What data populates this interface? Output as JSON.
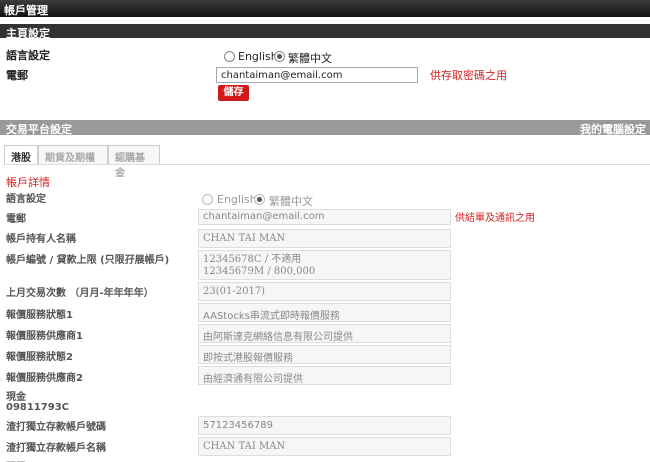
{
  "window": {
    "title": "帳戶管理"
  },
  "home": {
    "section_title": "主頁設定",
    "language_label": "語言設定",
    "language_options": [
      "English",
      "繁體中文"
    ],
    "email_label": "電郵",
    "email_value": "chantaiman@email.com",
    "email_hint": "供存取密碼之用",
    "save_label": "儲存"
  },
  "trading": {
    "section_title": "交易平台設定",
    "right_link": "我的電腦設定",
    "tabs": [
      "港股",
      "期貨及期權",
      "認購基金"
    ],
    "subheader": "帳戶詳情",
    "language_label": "語言設定",
    "language_options": [
      "English",
      "繁體中文"
    ],
    "email_label": "電郵",
    "email_value": "chantaiman@email.com",
    "email_hint": "供結單及通訊之用",
    "holder_label": "帳戶持有人名稱",
    "holder_value": "CHAN TAI MAN",
    "account_label": "帳戶編號 / 貸款上限 (只限孖展帳戶)",
    "account_line1": "12345678C / 不適用",
    "account_line2": "12345679M / 800,000",
    "last_trade_label": "上月交易次數 （月月-年年年年）",
    "last_trade_value": "23(01-2017)",
    "quote_status1_label": "報價服務狀態1",
    "quote_status1_value": "AAStocks串流式即時報價服務",
    "quote_provider1_label": "報價服務供應商1",
    "quote_provider1_value": "由阿斯達克網絡信息有限公司提供",
    "quote_status2_label": "報價服務狀態2",
    "quote_status2_value": "即按式港股報價服務",
    "quote_provider2_label": "報價服務供應商2",
    "quote_provider2_value": "由經濟通有限公司提供",
    "cash_label": "現金",
    "cash_account": "09811793C",
    "sc_acct_no_label": "渣打獨立存款帳戶號碼",
    "sc_acct_no_value": "57123456789",
    "sc_acct_name_label": "渣打獨立存款帳戶名稱",
    "sc_acct_name_value": "CHAN TAI MAN",
    "next_label": "孖展"
  }
}
